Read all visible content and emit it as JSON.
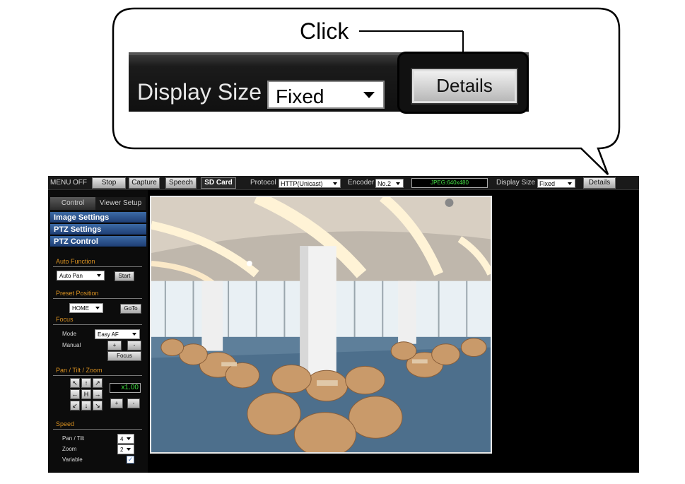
{
  "callout": {
    "instruction": "Click",
    "display_size_label": "Display Size",
    "display_size_value": "Fixed",
    "details_label": "Details"
  },
  "toolbar": {
    "menu_label": "MENU",
    "menu_state": "OFF",
    "stop_label": "Stop",
    "capture_label": "Capture",
    "speech_label": "Speech",
    "sdcard_label": "SD Card",
    "protocol_label": "Protocol",
    "protocol_value": "HTTP(Unicast)",
    "encoder_label": "Encoder",
    "encoder_value": "No.2",
    "stream_status": "JPEG:640x480",
    "display_size_label": "Display Size",
    "display_size_value": "Fixed",
    "details_label": "Details"
  },
  "sidebar": {
    "tabs": [
      {
        "label": "Control",
        "active": true
      },
      {
        "label": "Viewer Setup",
        "active": false
      }
    ],
    "menus": [
      "Image Settings",
      "PTZ Settings",
      "PTZ Control"
    ],
    "auto_function": {
      "title": "Auto Function",
      "value": "Auto Pan",
      "start_label": "Start"
    },
    "preset_position": {
      "title": "Preset Position",
      "value": "HOME",
      "goto_label": "GoTo"
    },
    "focus": {
      "title": "Focus",
      "mode_label": "Mode",
      "mode_value": "Easy AF",
      "manual_label": "Manual",
      "plus_label": "+",
      "minus_label": "-",
      "focus_button_label": "Focus"
    },
    "pan_tilt_zoom": {
      "title": "Pan / Tilt / Zoom",
      "zoom_value": "x1.00",
      "zoom_in_label": "+",
      "zoom_out_label": "-",
      "pad": [
        "↖",
        "↑",
        "↗",
        "←",
        "H",
        "→",
        "↙",
        "↓",
        "↘"
      ]
    },
    "speed": {
      "title": "Speed",
      "pan_tilt_label": "Pan / Tilt",
      "pan_tilt_value": "4",
      "zoom_label": "Zoom",
      "zoom_value": "2",
      "variable_label": "Variable",
      "variable_checked": true
    }
  },
  "colors": {
    "accordion_blue": "#2a5290",
    "section_orange": "#d89020",
    "status_green": "#46e046"
  }
}
